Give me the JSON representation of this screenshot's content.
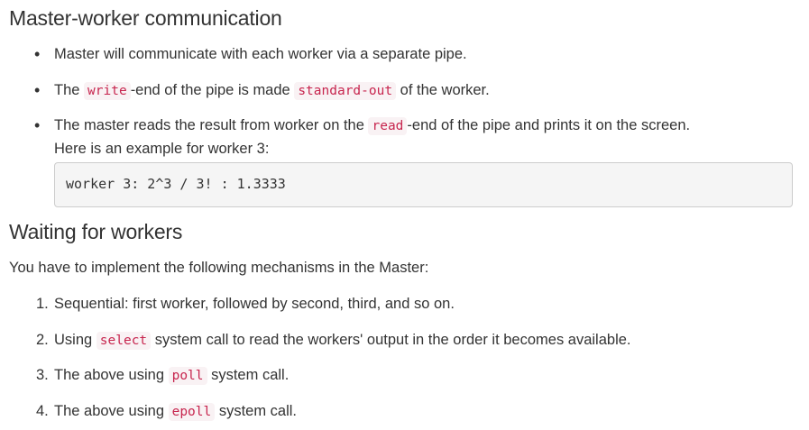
{
  "section1": {
    "heading": "Master-worker communication",
    "bullets": [
      {
        "text": "Master will communicate with each worker via a separate pipe."
      },
      {
        "pre": "The ",
        "code": "write",
        "post": "-end of the pipe is made ",
        "code2": "standard-out",
        "post2": " of the worker."
      },
      {
        "pre": "The master reads the result from worker on the ",
        "code": "read",
        "post": "-end of the pipe and prints it on the screen.",
        "line2": "Here is an example for worker 3:"
      }
    ],
    "example_output": "worker 3: 2^3 / 3! : 1.3333"
  },
  "section2": {
    "heading": "Waiting for workers",
    "intro": "You have to implement the following mechanisms in the Master:",
    "items": [
      {
        "num": "1.",
        "text": "Sequential: first worker, followed by second, third, and so on."
      },
      {
        "num": "2.",
        "pre": "Using ",
        "code": "select",
        "post": " system call to read the workers' output in the order it becomes available."
      },
      {
        "num": "3.",
        "pre": "The above using ",
        "code": "poll",
        "post": " system call."
      },
      {
        "num": "4.",
        "pre": "The above using ",
        "code": "epoll",
        "post": " system call."
      }
    ]
  }
}
